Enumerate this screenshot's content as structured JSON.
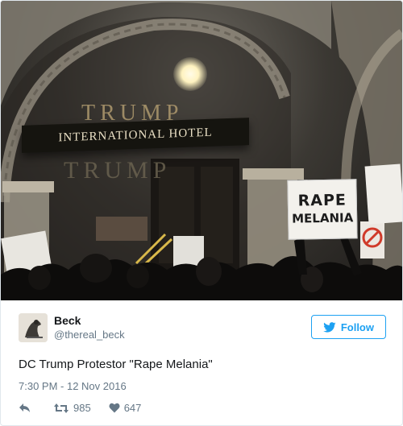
{
  "photo": {
    "sign_text": "INTERNATIONAL HOTEL",
    "facade_letters": "TRUMP",
    "shadow_letters": "TRUMP",
    "protest_sign": {
      "line1": "RAPE",
      "line2": "MELANIA"
    }
  },
  "tweet": {
    "author_name": "Beck",
    "handle": "@thereal_beck",
    "follow_label": "Follow",
    "text": "DC Trump Protestor \"Rape Melania\"",
    "timestamp": "7:30 PM - 12 Nov 2016",
    "retweets": "985",
    "likes": "647"
  },
  "icons": [
    "reply-icon",
    "retweet-icon",
    "heart-icon",
    "twitter-bird-icon"
  ],
  "colors": {
    "accent": "#1da1f2",
    "secondary_text": "#657786",
    "text": "#14171a"
  }
}
